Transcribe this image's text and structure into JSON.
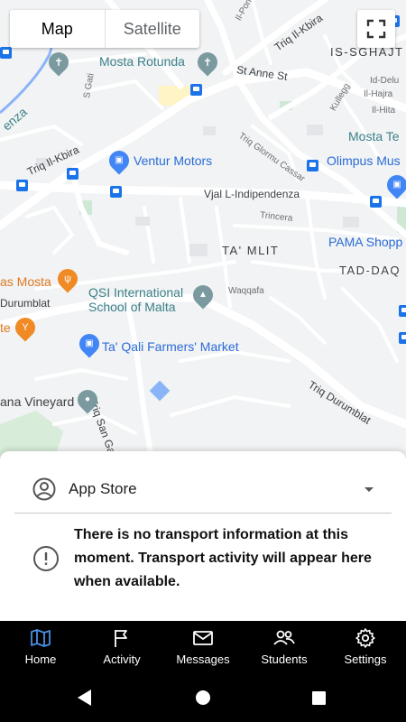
{
  "map": {
    "toggle": {
      "map_label": "Map",
      "satellite_label": "Satellite",
      "selected": "Map"
    },
    "labels": {
      "mosta_rotunda": "Mosta Rotunda",
      "st_anne": "St Anne St",
      "triq_il_kbira_top": "Triq Il-Kbira",
      "triq_il_kbira_left": "Triq Il-Kbira",
      "is_sghajt": "IS-SGHAJT",
      "ventur_motors": "Ventur Motors",
      "olimpus_mus": "Olimpus Mus",
      "mosta_te": "Mosta Te",
      "vjal": "Vjal L-Indipendenza",
      "trincera": "Trincera",
      "pama_shopp": "PAMA Shopp",
      "ta_mlit": "TA' MLIT",
      "tad_daq": "TAD-DAQ",
      "as_mosta": "as Mosta",
      "durumblat_left": "Durumblat",
      "qsi_school": "QSI International\nSchool of Malta",
      "waqqafa": "Waqqafa",
      "te": "te",
      "farmers_market": "Ta' Qali Farmers' Market",
      "triq_san_gakbu": "Triq San Gakbu",
      "triq_durumblat": "Triq Durumblat",
      "vineyard": "ana Vineyard",
      "s_gati": "S Gati",
      "il_pond": "Il-Pond",
      "kullegg": "Kullegg",
      "id_delu": "Id-Delu",
      "il_hajra": "Il-Hajra",
      "il_hita": "Il-Hita",
      "triq_glormu": "Triq Glormu Cassar",
      "enza": "enza"
    }
  },
  "sheet": {
    "app_selector": {
      "label": "App Store",
      "icon": "account-circle-icon"
    },
    "notice": {
      "icon": "info-icon",
      "message": "There is no transport information at this moment. Transport activity will appear here when available."
    }
  },
  "tabs": [
    {
      "label": "Home",
      "icon": "map-icon",
      "active": true
    },
    {
      "label": "Activity",
      "icon": "flag-icon",
      "active": false
    },
    {
      "label": "Messages",
      "icon": "mail-icon",
      "active": false
    },
    {
      "label": "Students",
      "icon": "people-icon",
      "active": false
    },
    {
      "label": "Settings",
      "icon": "gear-icon",
      "active": false
    }
  ],
  "colors": {
    "accent": "#1a73e8",
    "active_tab_icon": "#4a90e2",
    "tab_bar": "#000000",
    "map_background": "#f1f3f4"
  }
}
